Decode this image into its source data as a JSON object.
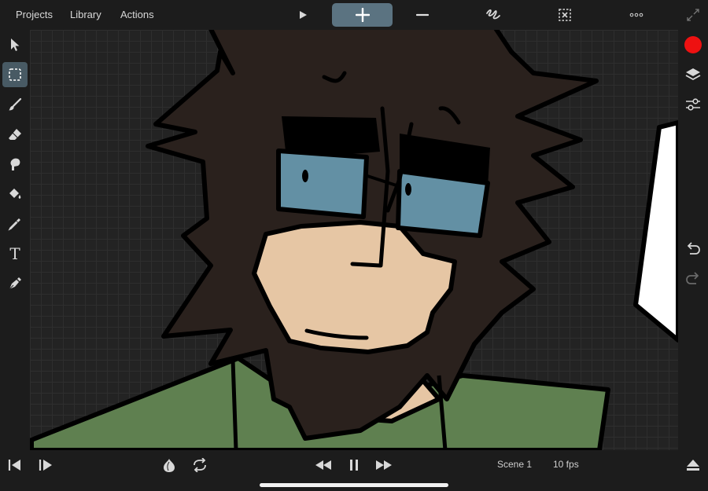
{
  "menu": {
    "projects": "Projects",
    "library": "Library",
    "actions": "Actions"
  },
  "toolbar": {
    "play": "play-icon",
    "add_frame": "plus-icon",
    "remove_frame": "minus-icon",
    "stroke": "scribble-icon",
    "clear": "clear-frame-icon",
    "more": "more-icon",
    "fullscreen": "expand-icon"
  },
  "tools": [
    {
      "name": "select-arrow-icon",
      "active": false
    },
    {
      "name": "lasso-select-icon",
      "active": true
    },
    {
      "name": "brush-icon",
      "active": false
    },
    {
      "name": "eraser-icon",
      "active": false
    },
    {
      "name": "smudge-icon",
      "active": false
    },
    {
      "name": "fill-bucket-icon",
      "active": false
    },
    {
      "name": "eyedropper-icon",
      "active": false
    },
    {
      "name": "text-tool-icon",
      "active": false
    },
    {
      "name": "pen-icon",
      "active": false
    }
  ],
  "text_tool_glyph": "T",
  "right_tools": {
    "current_color": "#ee1111",
    "layers": "layers-icon",
    "adjust": "sliders-icon",
    "undo": "undo-icon",
    "redo": "redo-icon"
  },
  "colors": {
    "accent": "#5b7381",
    "hair": "#2a211d",
    "skin": "#e6c6a4",
    "lens": "#6390a4",
    "shirt": "#5f8050",
    "outline": "#000000",
    "paper": "#ffffff"
  },
  "playback": {
    "scene": "Scene 1",
    "fps": "10 fps"
  }
}
